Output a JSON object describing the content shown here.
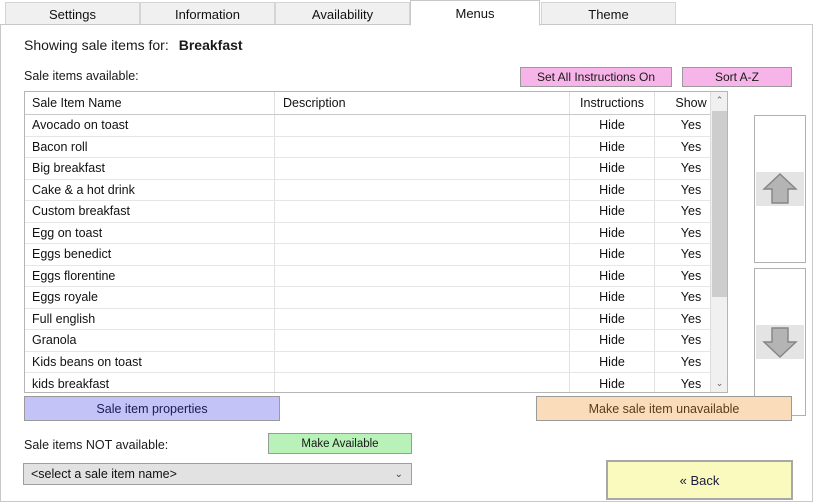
{
  "tabs": [
    {
      "label": "Settings",
      "active": false
    },
    {
      "label": "Information",
      "active": false
    },
    {
      "label": "Availability",
      "active": false
    },
    {
      "label": "Menus",
      "active": true
    },
    {
      "label": "Theme",
      "active": false
    }
  ],
  "header": {
    "showing_label": "Showing sale items for:",
    "showing_value": "Breakfast"
  },
  "available_section": {
    "label": "Sale items available:",
    "set_all_instructions_label": "Set All Instructions On",
    "sort_label": "Sort A-Z"
  },
  "table": {
    "columns": [
      "Sale Item Name",
      "Description",
      "Instructions",
      "Show"
    ],
    "rows": [
      {
        "name": "Avocado on toast",
        "description": "",
        "instructions": "Hide",
        "show": "Yes"
      },
      {
        "name": "Bacon roll",
        "description": "",
        "instructions": "Hide",
        "show": "Yes"
      },
      {
        "name": "Big breakfast",
        "description": "",
        "instructions": "Hide",
        "show": "Yes"
      },
      {
        "name": "Cake & a hot drink",
        "description": "",
        "instructions": "Hide",
        "show": "Yes"
      },
      {
        "name": "Custom breakfast",
        "description": "",
        "instructions": "Hide",
        "show": "Yes"
      },
      {
        "name": "Egg on toast",
        "description": "",
        "instructions": "Hide",
        "show": "Yes"
      },
      {
        "name": "Eggs benedict",
        "description": "",
        "instructions": "Hide",
        "show": "Yes"
      },
      {
        "name": "Eggs florentine",
        "description": "",
        "instructions": "Hide",
        "show": "Yes"
      },
      {
        "name": "Eggs royale",
        "description": "",
        "instructions": "Hide",
        "show": "Yes"
      },
      {
        "name": "Full english",
        "description": "",
        "instructions": "Hide",
        "show": "Yes"
      },
      {
        "name": "Granola",
        "description": "",
        "instructions": "Hide",
        "show": "Yes"
      },
      {
        "name": "Kids beans on toast",
        "description": "",
        "instructions": "Hide",
        "show": "Yes"
      },
      {
        "name": "kids breakfast",
        "description": "",
        "instructions": "Hide",
        "show": "Yes"
      }
    ]
  },
  "scrollbar": {
    "up_glyph": "⌃",
    "down_glyph": "⌄"
  },
  "move_buttons": {
    "up_name": "move-item-up",
    "down_name": "move-item-down"
  },
  "actions": {
    "properties_label": "Sale item properties",
    "unavailable_label": "Make sale item unavailable"
  },
  "not_available_section": {
    "label": "Sale items NOT available:",
    "make_available_label": "Make Available",
    "select_value": "<select a sale item name>",
    "caret_glyph": "⌄"
  },
  "footer": {
    "back_label": "« Back"
  },
  "colors": {
    "pink_button": "#f7b4e8",
    "purple_button": "#c3c3f7",
    "peach_button": "#fbdcba",
    "green_button": "#b8f2b8",
    "yellow_button": "#fafabe"
  }
}
